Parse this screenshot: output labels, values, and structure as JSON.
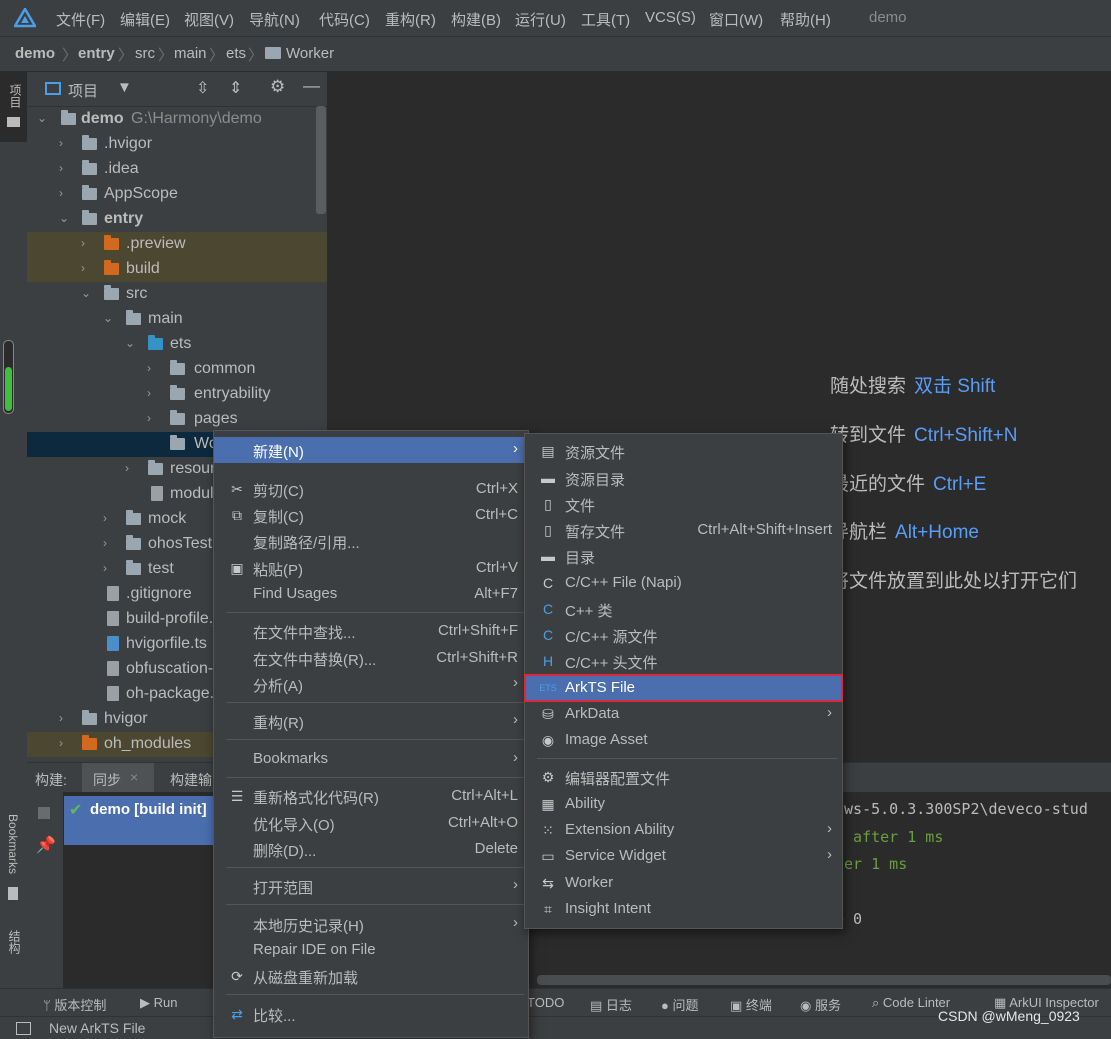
{
  "menubar": {
    "items": [
      "文件(F)",
      "编辑(E)",
      "视图(V)",
      "导航(N)",
      "代码(C)",
      "重构(R)",
      "构建(B)",
      "运行(U)",
      "工具(T)",
      "VCS(S)",
      "窗口(W)",
      "帮助(H)"
    ],
    "project_title": "demo"
  },
  "breadcrumb": [
    "demo",
    "entry",
    "src",
    "main",
    "ets",
    "Worker"
  ],
  "left_strip": {
    "project": "项目",
    "bookmarks": "Bookmarks",
    "structure": "结构"
  },
  "project_panel": {
    "title": "项目",
    "tree": [
      {
        "label": "demo",
        "extra": "G:\\Harmony\\demo",
        "bold": true
      },
      {
        "label": ".hvigor"
      },
      {
        "label": ".idea"
      },
      {
        "label": "AppScope"
      },
      {
        "label": "entry",
        "bold": true
      },
      {
        "label": ".preview"
      },
      {
        "label": "build"
      },
      {
        "label": "src"
      },
      {
        "label": "main"
      },
      {
        "label": "ets"
      },
      {
        "label": "common"
      },
      {
        "label": "entryability"
      },
      {
        "label": "pages"
      },
      {
        "label": "Worker"
      },
      {
        "label": "resources"
      },
      {
        "label": "module.json5"
      },
      {
        "label": "mock"
      },
      {
        "label": "ohosTest"
      },
      {
        "label": "test"
      },
      {
        "label": ".gitignore"
      },
      {
        "label": "build-profile.json5"
      },
      {
        "label": "hvigorfile.ts"
      },
      {
        "label": "obfuscation-rules.txt"
      },
      {
        "label": "oh-package.json5"
      },
      {
        "label": "hvigor"
      },
      {
        "label": "oh_modules"
      }
    ]
  },
  "editor_hints": [
    {
      "text": "随处搜索",
      "key": "双击 Shift"
    },
    {
      "text": "转到文件",
      "key": "Ctrl+Shift+N"
    },
    {
      "text": "最近的文件",
      "key": "Ctrl+E"
    },
    {
      "text": "导航栏",
      "key": "Alt+Home"
    },
    {
      "text": "将文件放置到此处以打开它们",
      "key": ""
    }
  ],
  "build_panel": {
    "label": "构建:",
    "tab_sync": "同步",
    "tab_build": "构建输出",
    "task": "demo [build init]",
    "console": [
      "ows-5.0.3.300SP2\\deveco-stud",
      ". after 1 ms",
      "ter 1 ms",
      "e 0"
    ]
  },
  "context_menu": {
    "items": [
      {
        "label": "新建(N)",
        "shortcut": "",
        "submenu": true
      },
      {
        "label": "剪切(C)",
        "shortcut": "Ctrl+X",
        "icon": "cut-icon"
      },
      {
        "label": "复制(C)",
        "shortcut": "Ctrl+C",
        "icon": "copy-icon"
      },
      {
        "label": "复制路径/引用...",
        "shortcut": ""
      },
      {
        "label": "粘贴(P)",
        "shortcut": "Ctrl+V",
        "icon": "paste-icon"
      },
      {
        "label": "Find Usages",
        "shortcut": "Alt+F7"
      },
      {
        "label": "在文件中查找...",
        "shortcut": "Ctrl+Shift+F"
      },
      {
        "label": "在文件中替换(R)...",
        "shortcut": "Ctrl+Shift+R"
      },
      {
        "label": "分析(A)",
        "shortcut": "",
        "submenu": true
      },
      {
        "label": "重构(R)",
        "shortcut": "",
        "submenu": true
      },
      {
        "label": "Bookmarks",
        "shortcut": "",
        "submenu": true
      },
      {
        "label": "重新格式化代码(R)",
        "shortcut": "Ctrl+Alt+L",
        "icon": "reformat-icon"
      },
      {
        "label": "优化导入(O)",
        "shortcut": "Ctrl+Alt+O"
      },
      {
        "label": "删除(D)...",
        "shortcut": "Delete"
      },
      {
        "label": "打开范围",
        "shortcut": "",
        "submenu": true
      },
      {
        "label": "本地历史记录(H)",
        "shortcut": "",
        "submenu": true
      },
      {
        "label": "Repair IDE on File",
        "shortcut": ""
      },
      {
        "label": "从磁盘重新加载",
        "shortcut": "",
        "icon": "reload-icon"
      },
      {
        "label": "比较...",
        "shortcut": "",
        "icon": "compare-icon"
      }
    ]
  },
  "new_submenu": {
    "items": [
      {
        "label": "资源文件"
      },
      {
        "label": "资源目录"
      },
      {
        "label": "文件"
      },
      {
        "label": "暂存文件",
        "shortcut": "Ctrl+Alt+Shift+Insert"
      },
      {
        "label": "目录"
      },
      {
        "label": "C/C++ File (Napi)"
      },
      {
        "label": "C++ 类"
      },
      {
        "label": "C/C++ 源文件"
      },
      {
        "label": "C/C++ 头文件"
      },
      {
        "label": "ArkTS File",
        "highlight": true
      },
      {
        "label": "ArkData",
        "submenu": true
      },
      {
        "label": "Image Asset"
      },
      {
        "label": "编辑器配置文件"
      },
      {
        "label": "Ability"
      },
      {
        "label": "Extension Ability",
        "submenu": true
      },
      {
        "label": "Service Widget",
        "submenu": true
      },
      {
        "label": "Worker"
      },
      {
        "label": "Insight Intent"
      }
    ]
  },
  "toolbar": [
    "版本控制",
    "Run",
    "TODO",
    "日志",
    "问题",
    "终端",
    "服务",
    "Code Linter",
    "ArkUI Inspector"
  ],
  "statusbar": {
    "text": "New ArkTS File"
  },
  "watermark": "CSDN @wMeng_0923",
  "colors": {
    "accent": "#4b6eaf",
    "link": "#589df6",
    "highlight_border": "#e0263a",
    "bg": "#2b2b2b",
    "panel": "#3c3f41"
  }
}
